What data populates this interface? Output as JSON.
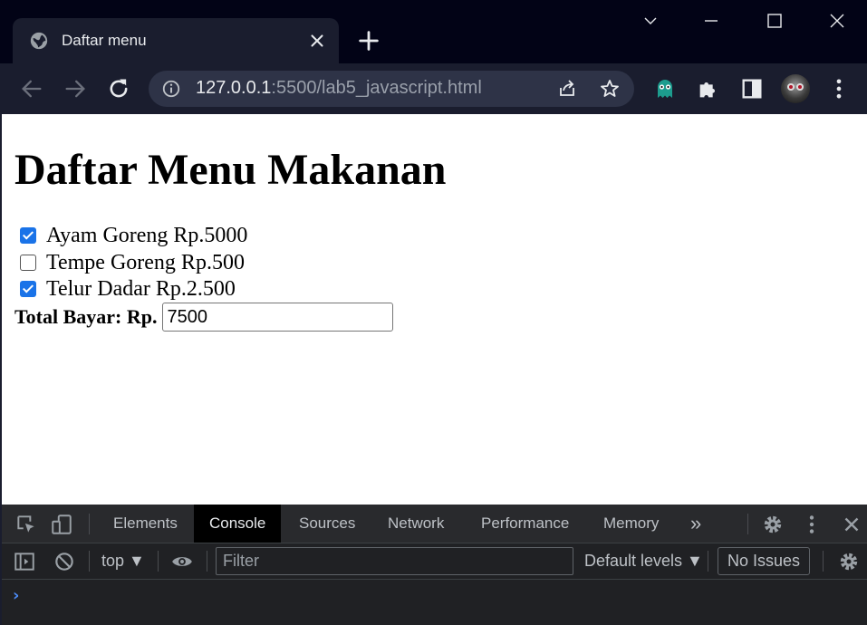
{
  "browser": {
    "tab_title": "Daftar menu",
    "url_host": "127.0.0.1",
    "url_rest": ":5500/lab5_javascript.html",
    "icons": {
      "tab_favicon": "globe-icon",
      "tab_close": "close-icon",
      "new_tab": "plus-icon",
      "tab_search": "chevron-down-icon",
      "minimize": "minimize-icon",
      "maximize": "maximize-icon",
      "close_window": "close-icon",
      "back": "back-arrow-icon",
      "forward": "forward-arrow-icon",
      "reload": "reload-icon",
      "site_info": "info-icon",
      "share": "share-icon",
      "bookmark": "star-icon",
      "extension": "ghost-extension-icon",
      "extensions_menu": "puzzle-icon",
      "side_panel": "side-panel-icon",
      "profile": "profile-avatar",
      "more": "more-vertical-icon"
    }
  },
  "page": {
    "title": "Daftar Menu Makanan",
    "menu_items": [
      {
        "label": "Ayam Goreng Rp.5000",
        "checked": true
      },
      {
        "label": "Tempe Goreng Rp.500",
        "checked": false
      },
      {
        "label": "Telur Dadar Rp.2.500",
        "checked": true
      }
    ],
    "total_label": "Total Bayar: Rp.",
    "total_value": "7500"
  },
  "devtools": {
    "tabs": [
      "Elements",
      "Console",
      "Sources",
      "Network",
      "Performance",
      "Memory"
    ],
    "active_tab": "Console",
    "more_tabs": "»",
    "context": "top ▼",
    "filter_placeholder": "Filter",
    "levels": "Default levels ▼",
    "issues": "No Issues",
    "prompt": "›",
    "colors": {
      "active_tab_bg": "#000000",
      "checkbox_accent": "#1a73e8",
      "prompt": "#4c8bf5"
    }
  }
}
